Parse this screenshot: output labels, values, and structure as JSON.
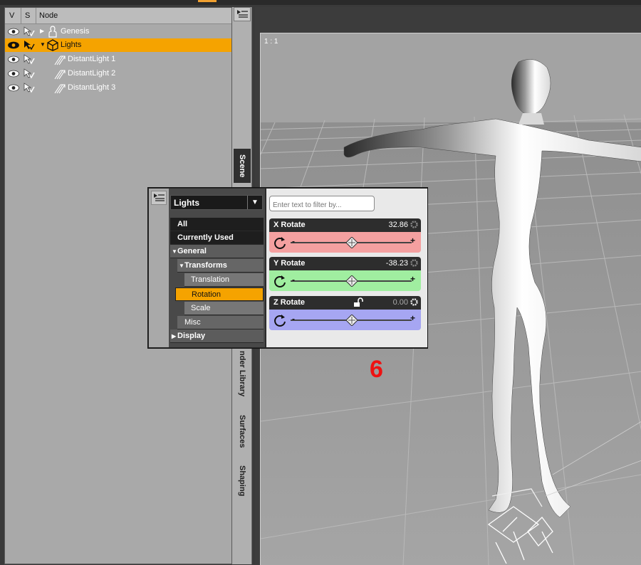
{
  "scene": {
    "header": {
      "v": "V",
      "s": "S",
      "node": "Node"
    },
    "nodes": [
      {
        "label": "Genesis"
      },
      {
        "label": "Lights"
      },
      {
        "label": "DistantLight 1"
      },
      {
        "label": "DistantLight 2"
      },
      {
        "label": "DistantLight 3"
      }
    ]
  },
  "side_tabs": {
    "scene": "Scene",
    "render_library": "nder Library",
    "surfaces": "Surfaces",
    "shaping": "Shaping"
  },
  "viewport": {
    "label": "1 : 1"
  },
  "parameters": {
    "category_dropdown": "Lights",
    "filter_placeholder": "Enter text to filter by...",
    "categories": {
      "all": "All",
      "currently_used": "Currently Used",
      "general": "General",
      "transforms": "Transforms",
      "translation": "Translation",
      "rotation": "Rotation",
      "scale": "Scale",
      "misc": "Misc",
      "display": "Display"
    },
    "sliders": [
      {
        "name": "X Rotate",
        "value": "32.86",
        "value_num": 32.86,
        "color": "#f4a0a0"
      },
      {
        "name": "Y Rotate",
        "value": "-38.23",
        "value_num": -38.23,
        "color": "#a0eea0"
      },
      {
        "name": "Z Rotate",
        "value": "0.00",
        "value_num": 0.0,
        "color": "#a6a6f2"
      }
    ],
    "minus": "-",
    "plus": "+"
  },
  "annotation": {
    "number": "6"
  },
  "colors": {
    "selection": "#f5a300",
    "annotation": "#ee1111"
  }
}
